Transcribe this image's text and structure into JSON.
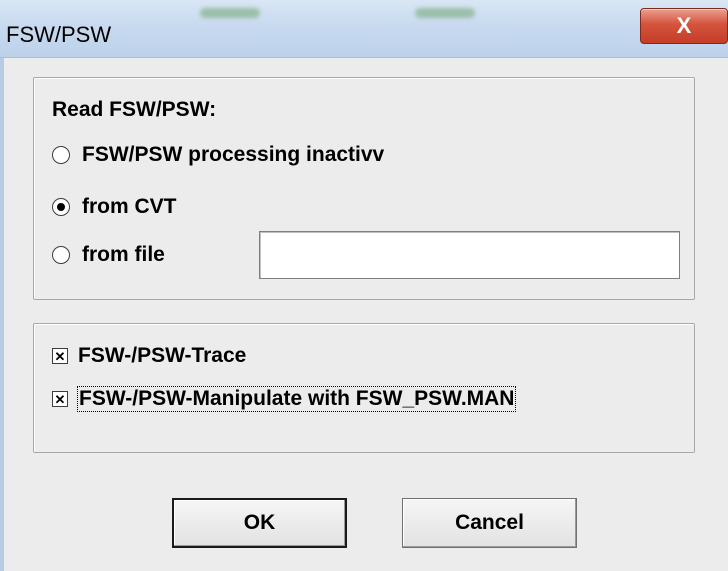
{
  "window": {
    "title": "FSW/PSW",
    "close_label": "X"
  },
  "read_group": {
    "label": "Read FSW/PSW:",
    "options": [
      {
        "label": "FSW/PSW processing inactivv",
        "checked": false
      },
      {
        "label": "from CVT",
        "checked": true
      },
      {
        "label": "from file",
        "checked": false
      }
    ],
    "file_value": ""
  },
  "options_group": {
    "items": [
      {
        "label": "FSW-/PSW-Trace",
        "checked": true,
        "mark": "✕"
      },
      {
        "label": "FSW-/PSW-Manipulate with FSW_PSW.MAN",
        "checked": true,
        "mark": "✕"
      }
    ]
  },
  "buttons": {
    "ok": "OK",
    "cancel": "Cancel"
  }
}
